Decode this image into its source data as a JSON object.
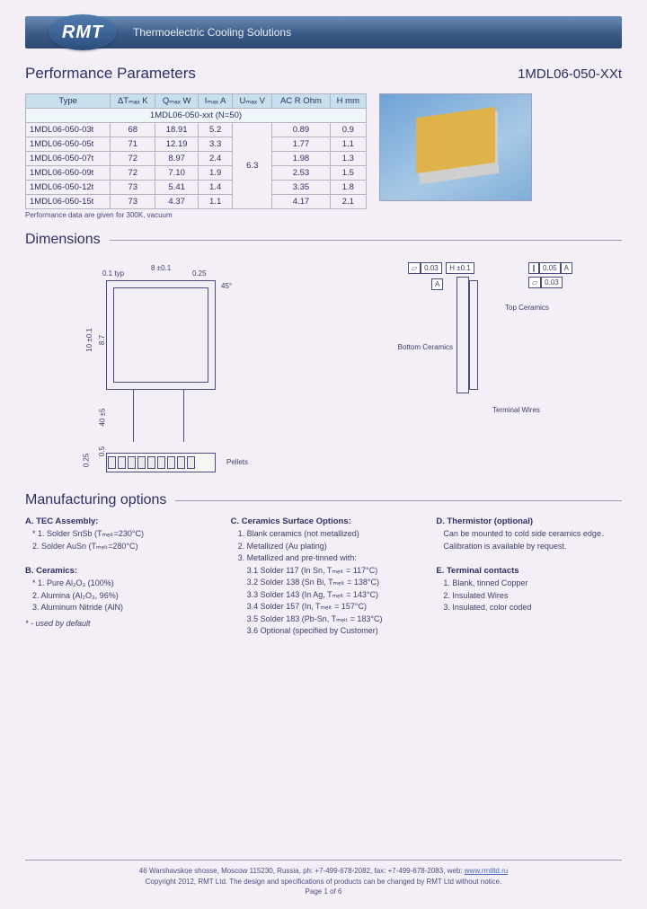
{
  "header": {
    "logo": "RMT",
    "tagline": "Thermoelectric Cooling Solutions"
  },
  "title": "Performance Parameters",
  "partno": "1MDL06-050-XXt",
  "table": {
    "headers": [
      "Type",
      "ΔTₘₐₓ K",
      "Qₘₐₓ W",
      "Iₘₐₓ A",
      "Uₘₐₓ V",
      "AC R Ohm",
      "H mm"
    ],
    "subheader": "1MDL06-050-xxt (N=50)",
    "umax_shared": "6.3",
    "rows": [
      {
        "type": "1MDL06-050-03t",
        "dt": "68",
        "q": "18.91",
        "i": "5.2",
        "r": "0.89",
        "h": "0.9"
      },
      {
        "type": "1MDL06-050-05t",
        "dt": "71",
        "q": "12.19",
        "i": "3.3",
        "r": "1.77",
        "h": "1.1"
      },
      {
        "type": "1MDL06-050-07t",
        "dt": "72",
        "q": "8.97",
        "i": "2.4",
        "r": "1.98",
        "h": "1.3"
      },
      {
        "type": "1MDL06-050-09t",
        "dt": "72",
        "q": "7.10",
        "i": "1.9",
        "r": "2.53",
        "h": "1.5"
      },
      {
        "type": "1MDL06-050-12t",
        "dt": "73",
        "q": "5.41",
        "i": "1.4",
        "r": "3.35",
        "h": "1.8"
      },
      {
        "type": "1MDL06-050-15t",
        "dt": "73",
        "q": "4.37",
        "i": "1.1",
        "r": "4.17",
        "h": "2.1"
      }
    ],
    "note": "Performance data are given for 300K, vacuum"
  },
  "sections": {
    "dimensions": "Dimensions",
    "mfg": "Manufacturing options"
  },
  "dim": {
    "w": "8 ±0.1",
    "typ": "0.1 typ",
    "dim025": "0.25",
    "dim05": "0.5",
    "ang": "45°",
    "h": "10 ±0.1",
    "inner_h": "8.7",
    "leads": "40 ±5",
    "tol1": "0.03",
    "tol2": "H ±0.1",
    "tol3": "0.05",
    "tol3a": "A",
    "tol4": "0.03",
    "lbl_top": "Top Ceramics",
    "lbl_bot": "Bottom Ceramics",
    "lbl_term": "Terminal Wires",
    "lbl_pellets": "Pellets"
  },
  "mfg": {
    "a_title": "A. TEC Assembly:",
    "a1": "* 1. Solder SnSb (Tₘₑₗₜ=230°C)",
    "a2": "2. Solder AuSn (Tₘₑₗₜ=280°C)",
    "b_title": "B. Ceramics:",
    "b1": "* 1. Pure Al₂O₃ (100%)",
    "b2": "2. Alumina (Al₂O₃, 96%)",
    "b3": "3. Aluminum Nitride (AlN)",
    "b_note": "* - used by default",
    "c_title": "C. Ceramics Surface Options:",
    "c1": "1. Blank ceramics (not metallized)",
    "c2": "2. Metallized (Au plating)",
    "c3": "3. Metallized and pre-tinned with:",
    "c31": "3.1 Solder 117 (In Sn, Tₘₑₗₜ = 117°C)",
    "c32": "3.2 Solder 138 (Sn Bi, Tₘₑₗₜ = 138°C)",
    "c33": "3.3 Solder 143 (In Ag, Tₘₑₗₜ = 143°C)",
    "c34": "3.4 Solder 157 (In, Tₘₑₗₜ = 157°C)",
    "c35": "3.5 Solder 183 (Pb-Sn, Tₘₑₗₜ = 183°C)",
    "c36": "3.6 Optional (specified by Customer)",
    "d_title": "D. Thermistor (optional)",
    "d_text": "Can be mounted to cold side ceramics edge. Calibration is available by request.",
    "e_title": "E. Terminal contacts",
    "e1": "1. Blank, tinned Copper",
    "e2": "2. Insulated Wires",
    "e3": "3. Insulated, color coded"
  },
  "footer": {
    "addr": "46 Warshavskoe shosse, Moscow 115230, Russia, ph: +7-499-678-2082, fax: +7-499-678-2083, web: ",
    "url": "www.rmtltd.ru",
    "copy": "Copyright 2012, RMT Ltd. The design and specifications of products can be changed by RMT Ltd without notice.",
    "page": "Page 1 of 6"
  }
}
